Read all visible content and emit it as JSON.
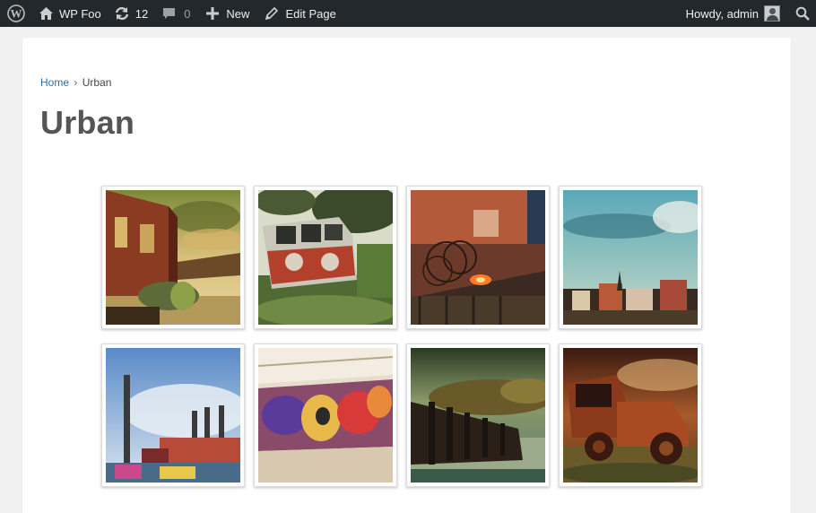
{
  "adminbar": {
    "site_name": "WP Foo",
    "updates_count": "12",
    "comments_count": "0",
    "new_label": "New",
    "edit_label": "Edit Page",
    "howdy": "Howdy, admin"
  },
  "breadcrumb": {
    "home": "Home",
    "separator": "›",
    "current": "Urban"
  },
  "page": {
    "title": "Urban"
  },
  "gallery": {
    "items": [
      {
        "subject": "brick building with graffiti pipe"
      },
      {
        "subject": "rusted van in overgrowth"
      },
      {
        "subject": "barbed wire with glowing light"
      },
      {
        "subject": "city skyline under teal sky"
      },
      {
        "subject": "factory smokestacks"
      },
      {
        "subject": "graffiti wall in tunnel"
      },
      {
        "subject": "wooden pier and trees"
      },
      {
        "subject": "rusted truck wreck"
      }
    ]
  },
  "colors": {
    "adminbar_bg": "#23282d",
    "link": "#2a6ea6",
    "title": "#555555",
    "page_bg": "#f1f1f1"
  }
}
